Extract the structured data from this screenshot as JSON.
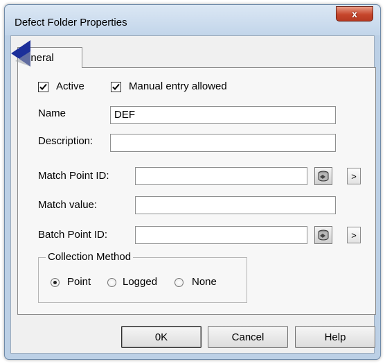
{
  "window": {
    "title": "Defect Folder Properties",
    "close_glyph": "x"
  },
  "tabs": [
    {
      "label": "General",
      "visible_label": "eneral",
      "active": true
    }
  ],
  "general": {
    "active": {
      "label": "Active",
      "checked": true
    },
    "manual_entry": {
      "label": "Manual entry allowed",
      "checked": true
    },
    "name": {
      "label": "Name",
      "value": "DEF"
    },
    "description": {
      "label": "Description:",
      "value": ""
    },
    "match_point_id": {
      "label": "Match Point ID:",
      "value": "",
      "browse_glyph": ">"
    },
    "match_value": {
      "label": "Match value:",
      "value": ""
    },
    "batch_point_id": {
      "label": "Batch Point ID:",
      "value": "",
      "browse_glyph": ">"
    },
    "collection_method": {
      "legend": "Collection  Method",
      "options": [
        {
          "label": "Point",
          "selected": true
        },
        {
          "label": "Logged",
          "selected": false
        },
        {
          "label": "None",
          "selected": false
        }
      ]
    }
  },
  "buttons": {
    "ok": "0K",
    "cancel": "Cancel",
    "help": "Help"
  },
  "icons": {
    "back": "back-arrow-icon",
    "lookup": "database-lookup-icon",
    "check": "checkmark-icon"
  },
  "colors": {
    "frame": "#bcd0e6",
    "close_button": "#c6462c",
    "back_arrow": "#1c2f9a"
  }
}
